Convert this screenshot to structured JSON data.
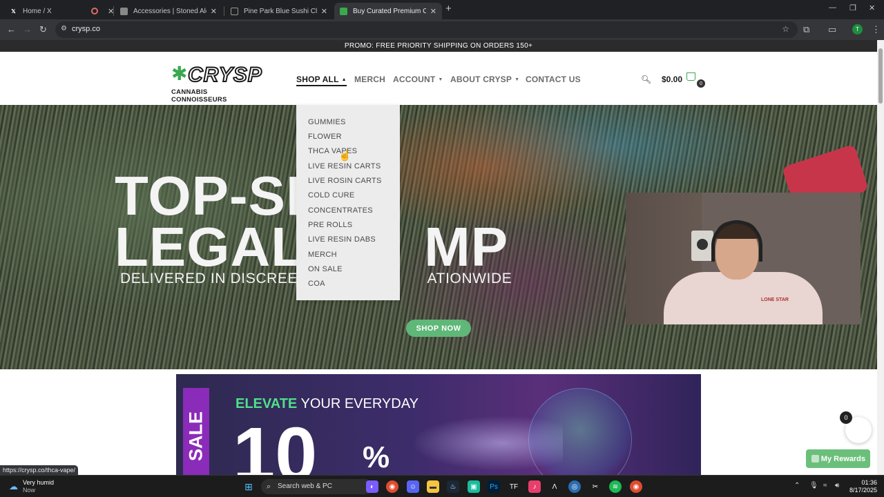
{
  "browser": {
    "tabs": [
      {
        "title": "Home / X",
        "favicon": "x-logo-icon"
      },
      {
        "title": "",
        "favicon": "record-icon"
      },
      {
        "title": "Accessories | Stoned Alchemist",
        "favicon": "site-icon"
      },
      {
        "title": "Pine Park Blue Sushi Classic Flo",
        "favicon": "site-icon"
      },
      {
        "title": "Buy Curated Premium Cannabis",
        "favicon": "site-icon",
        "active": true
      }
    ],
    "url": "crysp.co",
    "profile_initial": "T",
    "status_url": "https://crysp.co/thca-vape/"
  },
  "site": {
    "promo": "PROMO: FREE PRIORITY SHIPPING ON ORDERS 150+",
    "logo_word": "CRYSP",
    "logo_sub": "CANNABIS CONNOISSEURS",
    "nav": [
      {
        "label": "SHOP ALL",
        "dropdown": true,
        "active": true
      },
      {
        "label": "MERCH",
        "dropdown": false
      },
      {
        "label": "ACCOUNT",
        "dropdown": true
      },
      {
        "label": "ABOUT CRYSP",
        "dropdown": true
      },
      {
        "label": "CONTACT US",
        "dropdown": false
      }
    ],
    "cart_total": "$0.00",
    "cart_count": "0",
    "shop_menu": [
      "GUMMIES",
      "FLOWER",
      "THCA VAPES",
      "LIVE RESIN CARTS",
      "LIVE ROSIN CARTS",
      "COLD CURE",
      "CONCENTRATES",
      "PRE ROLLS",
      "LIVE RESIN DABS",
      "MERCH",
      "ON SALE",
      "COA"
    ],
    "hero": {
      "line1": "TOP-SHELF",
      "line2": "LEGAL HEMP",
      "visible_line1": "TOP-SF",
      "visible_line2_left": "LEGAL",
      "visible_line2_right": "MP",
      "tagline_left": "DELIVERED IN DISCREET",
      "tagline_right": "ATIONWIDE",
      "cta": "SHOP NOW"
    },
    "banner": {
      "sale": "SALE",
      "headline_accent": "ELEVATE",
      "headline_rest": "YOUR EVERYDAY",
      "big_number": "10",
      "percent": "%"
    },
    "rewards_label": "My Rewards",
    "fab_count": "0"
  },
  "webcam": {
    "shirt_text": "LONE STAR"
  },
  "taskbar": {
    "weather": "Very humid",
    "weather_sub": "Now",
    "search_placeholder": "Search web & PC",
    "time": "01:36",
    "date": "8/17/2025"
  },
  "colors": {
    "accent_green": "#5fb778",
    "promo_bar": "#2b2b2b",
    "sale_purple": "#8a2bb9"
  }
}
